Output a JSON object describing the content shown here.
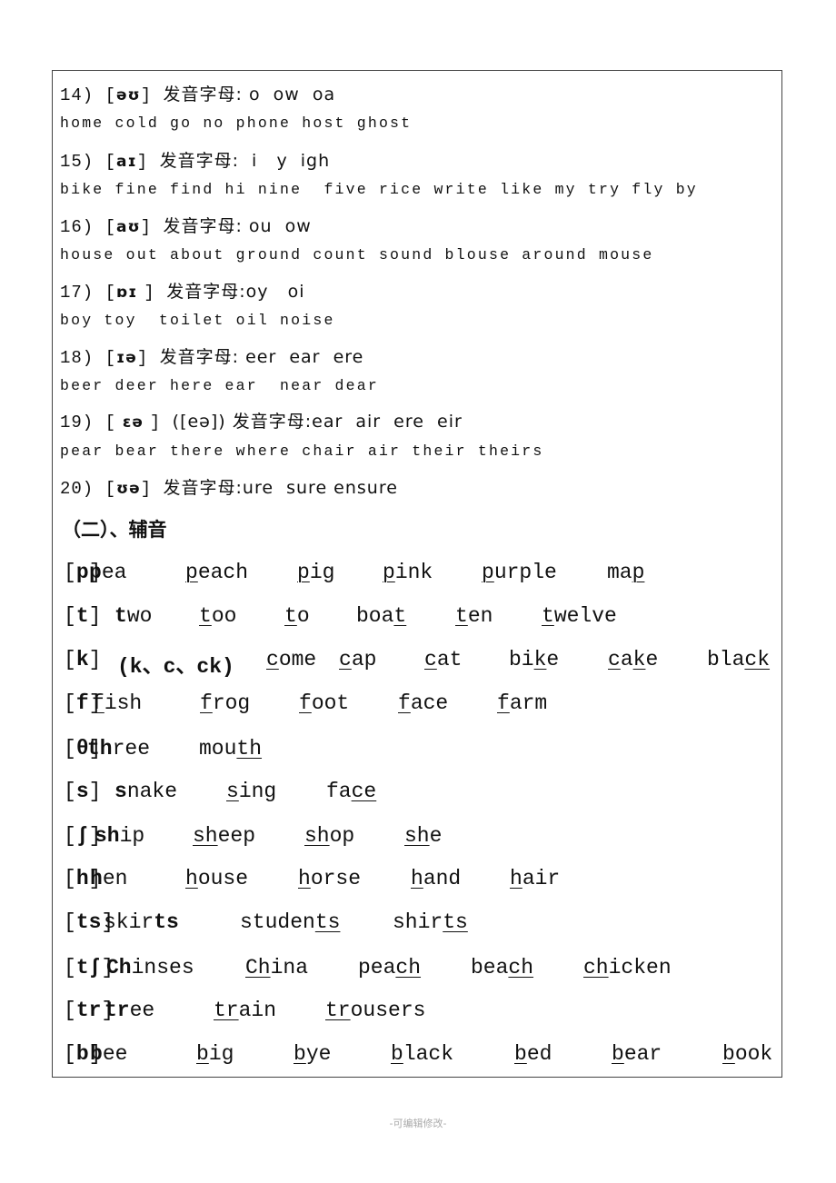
{
  "vowels": [
    {
      "type": "head",
      "num": "14)",
      "ipa": "əʊ",
      "rest": "发音字母: o  ow  oa"
    },
    {
      "type": "words",
      "text": "home cold go no phone host ghost"
    },
    {
      "type": "head",
      "num": "15)",
      "ipa": "aɪ",
      "rest": "发音字母:  i   y  igh"
    },
    {
      "type": "words",
      "text": "bike fine find hi nine  five rice write like my try fly by"
    },
    {
      "type": "head",
      "num": "16)",
      "ipa": "aʊ",
      "rest": "发音字母: ou  ow"
    },
    {
      "type": "words",
      "text": "house out about ground count sound blouse around mouse"
    },
    {
      "type": "head",
      "num": "17)",
      "ipa": "ɒɪ ",
      "rest": "发音字母:oy   oi"
    },
    {
      "type": "words",
      "text": "boy toy  toilet oil noise"
    },
    {
      "type": "head",
      "num": "18)",
      "ipa": "ɪə",
      "rest": "发音字母: eer  ear  ere"
    },
    {
      "type": "words",
      "text": "beer deer here ear  near dear"
    },
    {
      "type": "head",
      "num": "19)",
      "ipa": " ɛə ",
      "rest": "([eə]) 发音字母:ear  air  ere  eir"
    },
    {
      "type": "words",
      "text": "pear bear there where chair air their theirs"
    },
    {
      "type": "head",
      "num": "20)",
      "ipa": "ʊə",
      "rest": "发音字母:ure  sure ensure"
    }
  ],
  "consonant_heading": "（二）、辅音",
  "consonants": [
    [
      [
        {
          "t": "["
        },
        {
          "t": "p",
          "b": 1
        },
        {
          "t": "]"
        }
      ],
      [
        {
          "t": "p",
          "b": 1
        },
        {
          "t": "ea"
        }
      ],
      [
        {
          "t": "p",
          "u": 1
        },
        {
          "t": "each"
        }
      ],
      [
        {
          "t": "p",
          "u": 1
        },
        {
          "t": "ig"
        }
      ],
      [
        {
          "t": "p",
          "u": 1
        },
        {
          "t": "ink"
        }
      ],
      [
        {
          "t": "p",
          "u": 1
        },
        {
          "t": "urple"
        }
      ],
      [
        {
          "t": "ma"
        },
        {
          "t": "p",
          "u": 1
        }
      ]
    ],
    [
      [
        {
          "t": "["
        },
        {
          "t": "t",
          "b": 1
        },
        {
          "t": "]"
        }
      ],
      [
        {
          "t": "t",
          "b": 1
        },
        {
          "t": "wo"
        }
      ],
      [
        {
          "t": "t",
          "u": 1
        },
        {
          "t": "oo"
        }
      ],
      [
        {
          "t": "t",
          "u": 1
        },
        {
          "t": "o"
        }
      ],
      [
        {
          "t": "boa"
        },
        {
          "t": "t",
          "u": 1
        }
      ],
      [
        {
          "t": "t",
          "u": 1
        },
        {
          "t": "en"
        }
      ],
      [
        {
          "t": "t",
          "u": 1
        },
        {
          "t": "welve"
        }
      ]
    ],
    [
      [
        {
          "t": "["
        },
        {
          "t": "k",
          "b": 1
        },
        {
          "t": "]"
        }
      ],
      [
        {
          "t": "(k、c、ck)",
          "b": 1
        }
      ],
      [
        {
          "t": "c",
          "u": 1
        },
        {
          "t": "ome"
        }
      ],
      [
        {
          "t": "c",
          "u": 1
        },
        {
          "t": "ap"
        }
      ],
      [
        {
          "t": "c",
          "u": 1
        },
        {
          "t": "at"
        }
      ],
      [
        {
          "t": "bi"
        },
        {
          "t": "k",
          "u": 1
        },
        {
          "t": "e"
        }
      ],
      [
        {
          "t": "c",
          "u": 1
        },
        {
          "t": "a"
        },
        {
          "t": "k",
          "u": 1
        },
        {
          "t": "e"
        }
      ],
      [
        {
          "t": "bla"
        },
        {
          "t": "ck",
          "u": 1
        }
      ]
    ],
    [
      [
        {
          "t": "["
        },
        {
          "t": "f",
          "b": 1
        },
        {
          "t": "]"
        }
      ],
      [
        {
          "t": "f",
          "u": 1
        },
        {
          "t": "ish"
        }
      ],
      [
        {
          "t": "f",
          "u": 1
        },
        {
          "t": "rog"
        }
      ],
      [
        {
          "t": "f",
          "u": 1
        },
        {
          "t": "oot"
        }
      ],
      [
        {
          "t": "f",
          "u": 1
        },
        {
          "t": "ace"
        }
      ],
      [
        {
          "t": "f",
          "u": 1
        },
        {
          "t": "arm"
        }
      ]
    ],
    [
      [
        {
          "t": "["
        },
        {
          "t": "θ",
          "b": 1
        },
        {
          "t": "]"
        }
      ],
      [
        {
          "t": "th",
          "b": 1
        },
        {
          "t": "ree"
        }
      ],
      [
        {
          "t": "mou"
        },
        {
          "t": "th",
          "u": 1
        }
      ]
    ],
    [
      [
        {
          "t": "["
        },
        {
          "t": "s",
          "b": 1
        },
        {
          "t": "]"
        }
      ],
      [
        {
          "t": "s",
          "b": 1
        },
        {
          "t": "nake"
        }
      ],
      [
        {
          "t": "s",
          "u": 1
        },
        {
          "t": "ing"
        }
      ],
      [
        {
          "t": "fa"
        },
        {
          "t": "ce",
          "u": 1
        }
      ]
    ],
    [
      [
        {
          "t": "["
        },
        {
          "t": "ʃ",
          "b": 1
        },
        {
          "t": "]"
        }
      ],
      [
        {
          "t": "sh",
          "b": 1
        },
        {
          "t": "ip"
        }
      ],
      [
        {
          "t": "sh",
          "u": 1
        },
        {
          "t": "eep"
        }
      ],
      [
        {
          "t": "sh",
          "u": 1
        },
        {
          "t": "op"
        }
      ],
      [
        {
          "t": "sh",
          "u": 1
        },
        {
          "t": "e"
        }
      ]
    ],
    [
      [
        {
          "t": "["
        },
        {
          "t": "h",
          "b": 1
        },
        {
          "t": "]"
        }
      ],
      [
        {
          "t": "h",
          "b": 1
        },
        {
          "t": "en"
        }
      ],
      [
        {
          "t": "h",
          "u": 1
        },
        {
          "t": "ouse"
        }
      ],
      [
        {
          "t": "h",
          "u": 1
        },
        {
          "t": "orse"
        }
      ],
      [
        {
          "t": "h",
          "u": 1
        },
        {
          "t": "and"
        }
      ],
      [
        {
          "t": "h",
          "u": 1
        },
        {
          "t": "air"
        }
      ]
    ],
    [
      [
        {
          "t": "["
        },
        {
          "t": "ts",
          "b": 1
        },
        {
          "t": "]"
        }
      ],
      [
        {
          "t": "skir"
        },
        {
          "t": "ts",
          "b": 1
        }
      ],
      [
        {
          "t": "studen"
        },
        {
          "t": "ts",
          "u": 1
        }
      ],
      [
        {
          "t": "shir"
        },
        {
          "t": "ts",
          "u": 1
        }
      ]
    ],
    [
      [
        {
          "t": "["
        },
        {
          "t": "tʃ",
          "b": 1
        },
        {
          "t": "]"
        }
      ],
      [
        {
          "t": "Ch",
          "b": 1
        },
        {
          "t": "inses"
        }
      ],
      [
        {
          "t": "Ch",
          "u": 1
        },
        {
          "t": "ina"
        }
      ],
      [
        {
          "t": "pea"
        },
        {
          "t": "ch",
          "u": 1
        }
      ],
      [
        {
          "t": "bea"
        },
        {
          "t": "ch",
          "u": 1
        }
      ],
      [
        {
          "t": "ch",
          "u": 1
        },
        {
          "t": "icken"
        }
      ]
    ],
    [
      [
        {
          "t": "["
        },
        {
          "t": "tr",
          "b": 1
        },
        {
          "t": "]"
        }
      ],
      [
        {
          "t": "tr",
          "b": 1
        },
        {
          "t": "ee"
        }
      ],
      [
        {
          "t": "tr",
          "u": 1
        },
        {
          "t": "ain"
        }
      ],
      [
        {
          "t": "tr",
          "u": 1
        },
        {
          "t": "ousers"
        }
      ]
    ],
    [
      [
        {
          "t": "["
        },
        {
          "t": "b",
          "b": 1
        },
        {
          "t": "]"
        }
      ],
      [
        {
          "t": "b",
          "b": 1
        },
        {
          "t": "ee"
        }
      ],
      [
        {
          "t": "b",
          "u": 1
        },
        {
          "t": "ig"
        }
      ],
      [
        {
          "t": "b",
          "u": 1
        },
        {
          "t": "ye"
        }
      ],
      [
        {
          "t": "b",
          "u": 1
        },
        {
          "t": "lack"
        }
      ],
      [
        {
          "t": "b",
          "u": 1
        },
        {
          "t": "ed"
        }
      ],
      [
        {
          "t": "b",
          "u": 1
        },
        {
          "t": "ear"
        }
      ],
      [
        {
          "t": "b",
          "u": 1
        },
        {
          "t": "ook"
        }
      ]
    ]
  ],
  "footer": "-可编辑修改-"
}
